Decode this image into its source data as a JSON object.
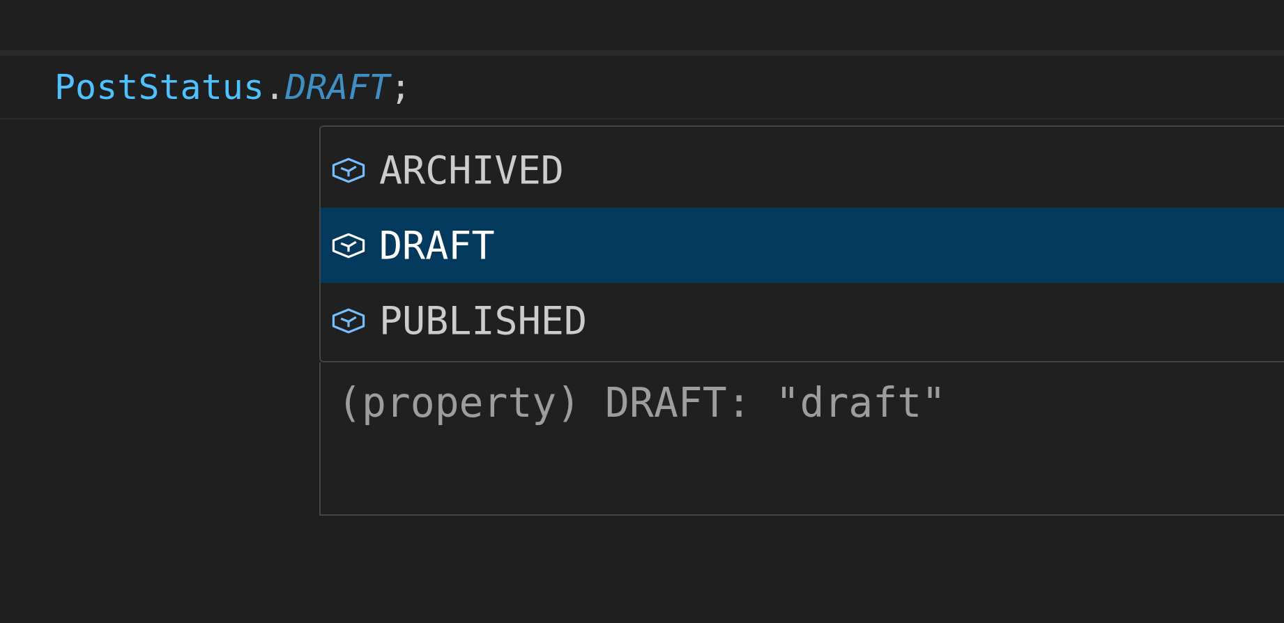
{
  "editor": {
    "code_line": [
      {
        "kind": "variable",
        "text": "PostStatus"
      },
      {
        "kind": "punctuation",
        "text": "."
      },
      {
        "kind": "property",
        "text": "DRAFT"
      },
      {
        "kind": "punctuation",
        "text": ";"
      }
    ]
  },
  "suggest": {
    "items": [
      {
        "label": "ARCHIVED",
        "selected": false
      },
      {
        "label": "DRAFT",
        "selected": true
      },
      {
        "label": "PUBLISHED",
        "selected": false
      }
    ]
  },
  "details": {
    "signature": "(property) DRAFT: \"draft\""
  }
}
